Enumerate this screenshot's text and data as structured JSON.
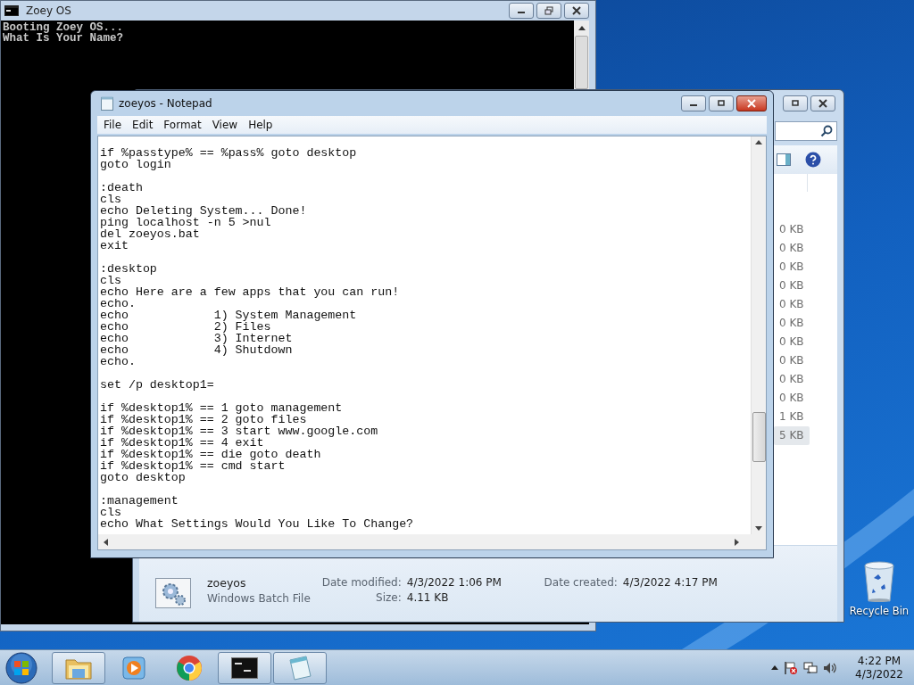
{
  "cmd_window": {
    "title": "Zoey OS",
    "lines": [
      "Booting Zoey OS...",
      "What Is Your Name?"
    ]
  },
  "explorer_window": {
    "sizes": [
      {
        "text": "0 KB",
        "selected": false
      },
      {
        "text": "0 KB",
        "selected": false
      },
      {
        "text": "0 KB",
        "selected": false
      },
      {
        "text": "0 KB",
        "selected": false
      },
      {
        "text": "0 KB",
        "selected": false
      },
      {
        "text": "0 KB",
        "selected": false
      },
      {
        "text": "0 KB",
        "selected": false
      },
      {
        "text": "0 KB",
        "selected": false
      },
      {
        "text": "0 KB",
        "selected": false
      },
      {
        "text": "0 KB",
        "selected": false
      },
      {
        "text": "1 KB",
        "selected": false
      },
      {
        "text": "5 KB",
        "selected": true
      }
    ],
    "details": {
      "name": "zoeyos",
      "type": "Windows Batch File",
      "fields": [
        {
          "label": "Date modified:",
          "value": "4/3/2022 1:06 PM"
        },
        {
          "label": "Size:",
          "value": "4.11 KB"
        },
        {
          "label": "Date created:",
          "value": "4/3/2022 4:17 PM"
        }
      ]
    }
  },
  "notepad_window": {
    "title": "zoeyos - Notepad",
    "menu": [
      "File",
      "Edit",
      "Format",
      "View",
      "Help"
    ],
    "content": "if %passtype% == %pass% goto desktop\ngoto login\n\n:death\ncls\necho Deleting System... Done!\nping localhost -n 5 >nul\ndel zoeyos.bat\nexit\n\n:desktop\ncls\necho Here are a few apps that you can run!\necho.\necho            1) System Management\necho            2) Files\necho            3) Internet\necho            4) Shutdown\necho.\n\nset /p desktop1=\n\nif %desktop1% == 1 goto management\nif %desktop1% == 2 goto files\nif %desktop1% == 3 start www.google.com\nif %desktop1% == 4 exit\nif %desktop1% == die goto death\nif %desktop1% == cmd start\ngoto desktop\n\n:management\ncls\necho What Settings Would You Like To Change?"
  },
  "desktop": {
    "icons": [
      {
        "label": "Recycle Bin"
      }
    ]
  },
  "taskbar": {
    "items": [
      {
        "kind": "explorer",
        "open": true
      },
      {
        "kind": "media",
        "open": false
      },
      {
        "kind": "browser",
        "open": false
      },
      {
        "kind": "console",
        "open": true
      },
      {
        "kind": "notepad",
        "open": true
      }
    ],
    "clock": {
      "time": "4:22 PM",
      "date": "4/3/2022"
    }
  }
}
